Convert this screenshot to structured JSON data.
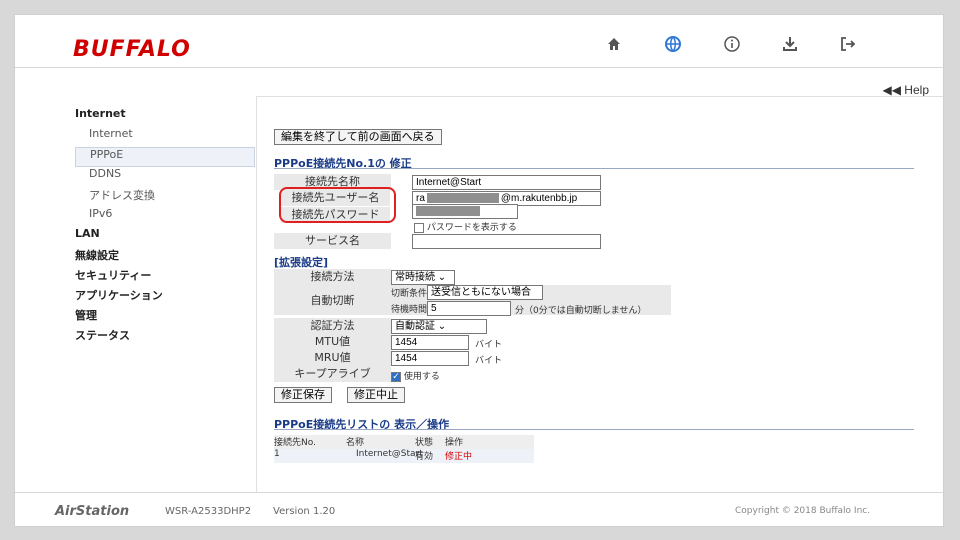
{
  "header": {
    "logo": "BUFFALO",
    "icons": [
      "home-icon",
      "globe-icon",
      "info-icon",
      "download-icon",
      "logout-icon"
    ]
  },
  "help_link": "◀◀ Help",
  "sidebar": {
    "items": [
      {
        "label": "Internet",
        "bold": true
      },
      {
        "label": "Internet",
        "indent": true
      },
      {
        "label": "PPPoE",
        "indent": true,
        "selected": true
      },
      {
        "label": "DDNS",
        "indent": true
      },
      {
        "label": "アドレス変換",
        "indent": true
      },
      {
        "label": "IPv6",
        "indent": true
      },
      {
        "label": "LAN",
        "bold": true
      },
      {
        "label": "無線設定",
        "bold": true
      },
      {
        "label": "セキュリティー",
        "bold": true
      },
      {
        "label": "アプリケーション",
        "bold": true
      },
      {
        "label": "管理",
        "bold": true
      },
      {
        "label": "ステータス",
        "bold": true
      }
    ]
  },
  "content": {
    "back_button": "編集を終了して前の画面へ戻る",
    "edit_title": "PPPoE接続先No.1の 修正",
    "fields": {
      "connection_name_label": "接続先名称",
      "connection_name_value": "Internet@Start",
      "username_label": "接続先ユーザー名",
      "username_prefix": "ra",
      "username_suffix": "@m.rakutenbb.jp",
      "password_label": "接続先パスワード",
      "show_password": "パスワードを表示する",
      "service_label": "サービス名",
      "service_value": ""
    },
    "extended_title": "[拡張設定]",
    "extended": {
      "method_label": "接続方法",
      "method_value": "常時接続",
      "auto_disconnect_label": "自動切断",
      "disconnect_condition_label": "切断条件",
      "disconnect_condition_value": "送受信ともにない場合",
      "wait_time_label": "待機時間",
      "wait_time_value": "5",
      "wait_time_note": "分（0分では自動切断しません）",
      "auth_label": "認証方法",
      "auth_value": "自動認証",
      "mtu_label": "MTU値",
      "mtu_value": "1454",
      "mtu_unit": "バイト",
      "mru_label": "MRU値",
      "mru_value": "1454",
      "mru_unit": "バイト",
      "keepalive_label": "キープアライブ",
      "keepalive_option": "使用する"
    },
    "save_button": "修正保存",
    "cancel_button": "修正中止",
    "list_title": "PPPoE接続先リストの 表示／操作",
    "list": {
      "headers": [
        "接続先No.",
        "名称",
        "状態",
        "操作"
      ],
      "rows": [
        {
          "no": "1",
          "name": "Internet@Start",
          "status": "有効",
          "action": "修正中"
        }
      ]
    }
  },
  "footer": {
    "brand": "AirStation",
    "model": "WSR-A2533DHP2",
    "version": "Version 1.20",
    "copyright": "Copyright © 2018 Buffalo Inc."
  }
}
